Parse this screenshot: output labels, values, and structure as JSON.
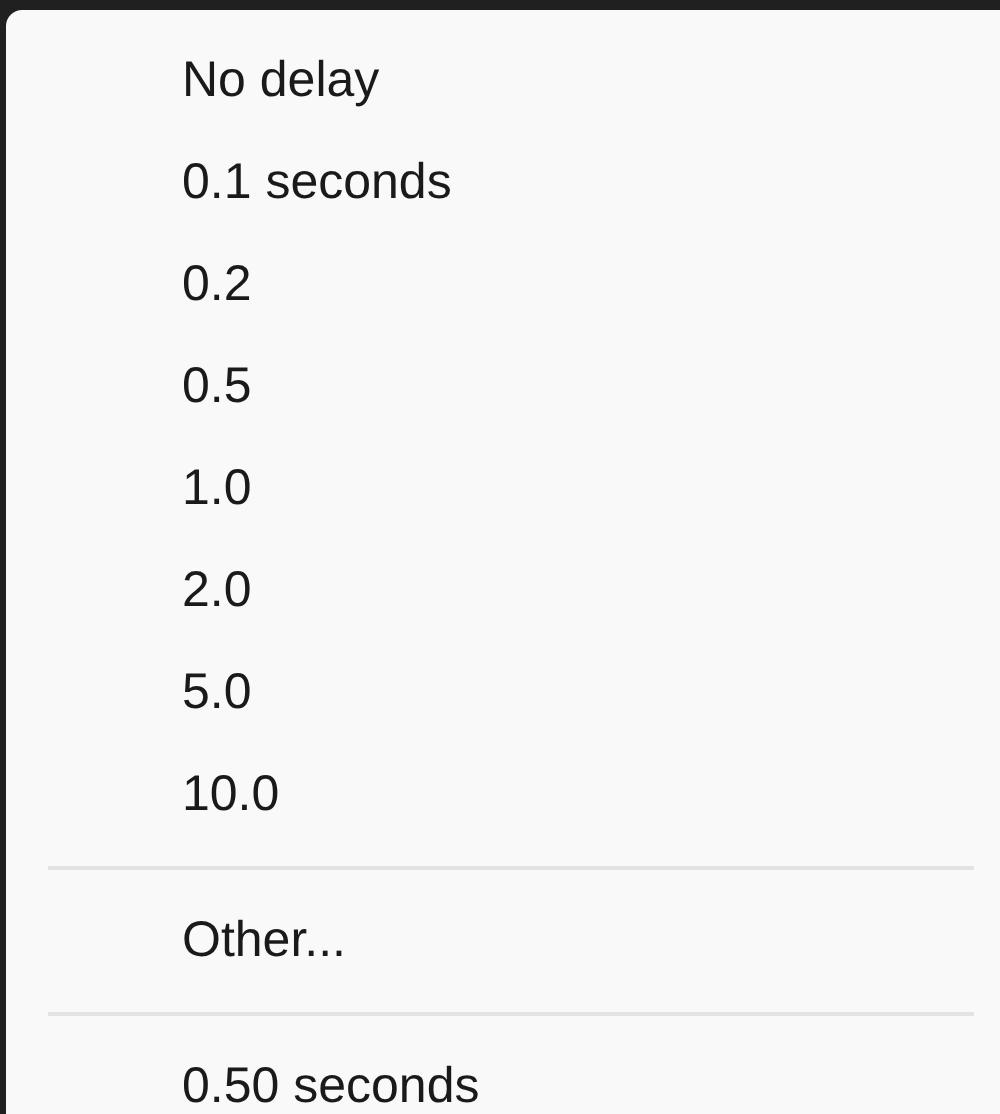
{
  "menu": {
    "items": [
      {
        "kind": "option",
        "label": "No delay"
      },
      {
        "kind": "option",
        "label": "0.1 seconds"
      },
      {
        "kind": "option",
        "label": "0.2"
      },
      {
        "kind": "option",
        "label": "0.5"
      },
      {
        "kind": "option",
        "label": "1.0"
      },
      {
        "kind": "option",
        "label": "2.0"
      },
      {
        "kind": "option",
        "label": "5.0"
      },
      {
        "kind": "option",
        "label": "10.0"
      },
      {
        "kind": "separator"
      },
      {
        "kind": "option",
        "label": "Other..."
      },
      {
        "kind": "separator"
      },
      {
        "kind": "option",
        "label": "0.50 seconds"
      }
    ]
  }
}
